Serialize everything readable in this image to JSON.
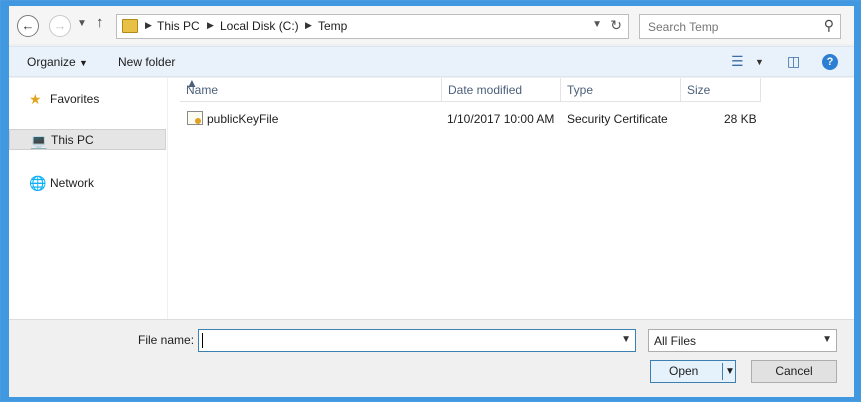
{
  "address_bar": {
    "back_icon": "back-arrow-icon",
    "forward_icon": "forward-arrow-icon",
    "recent_icon": "chevron-down-icon",
    "up_icon": "up-arrow-icon",
    "crumbs": [
      "This PC",
      "Local Disk (C:)",
      "Temp"
    ],
    "search_placeholder": "Search Temp"
  },
  "toolbar": {
    "organize_label": "Organize",
    "new_folder_label": "New folder"
  },
  "nav_pane": {
    "items": [
      {
        "label": "Favorites",
        "icon": "star-icon"
      },
      {
        "label": "This PC",
        "icon": "computer-icon",
        "selected": true
      },
      {
        "label": "Network",
        "icon": "network-icon"
      }
    ]
  },
  "file_list": {
    "columns": [
      "Name",
      "Date modified",
      "Type",
      "Size"
    ],
    "sort_column": "Name",
    "rows": [
      {
        "name": "publicKeyFile",
        "date_modified": "1/10/2017 10:00 AM",
        "type": "Security Certificate",
        "size": "28 KB",
        "icon": "certificate-icon"
      }
    ]
  },
  "footer": {
    "file_name_label": "File name:",
    "file_name_value": "",
    "filter_value": "All Files",
    "open_label": "Open",
    "cancel_label": "Cancel"
  },
  "colors": {
    "accent": "#3f98e0",
    "toolbar_bg": "#e9f1fa",
    "header_text": "#4c607a"
  }
}
